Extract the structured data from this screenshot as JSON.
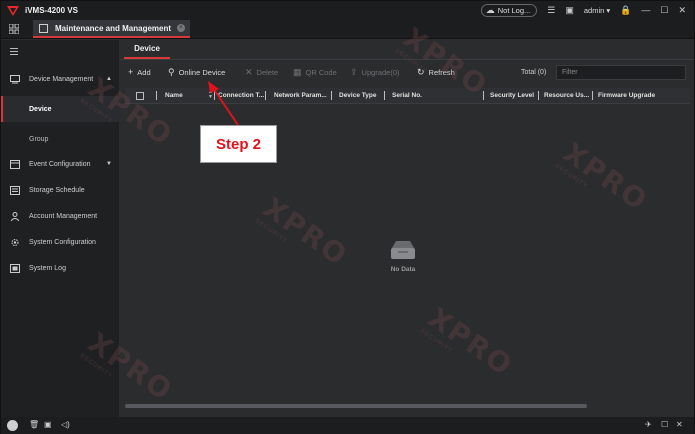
{
  "app": {
    "title": "iVMS-4200 VS",
    "not_logged": "Not Log...",
    "user": "admin"
  },
  "tab": {
    "label": "Maintenance and Management"
  },
  "sidebar": {
    "items": [
      {
        "label": "Device Management",
        "icon": "device-management-icon"
      },
      {
        "label": "Device"
      },
      {
        "label": "Group"
      },
      {
        "label": "Event Configuration",
        "icon": "event-config-icon"
      },
      {
        "label": "Storage Schedule",
        "icon": "storage-schedule-icon"
      },
      {
        "label": "Account Management",
        "icon": "account-icon"
      },
      {
        "label": "System Configuration",
        "icon": "gear-icon"
      },
      {
        "label": "System Log",
        "icon": "log-icon"
      }
    ]
  },
  "main": {
    "subtab": "Device",
    "toolbar": {
      "add": "Add",
      "online_device": "Online Device",
      "delete": "Delete",
      "qr_code": "QR Code",
      "upgrade": "Upgrade(0)",
      "refresh": "Refresh",
      "total": "Total (0)",
      "filter_placeholder": "Filter"
    },
    "columns": [
      "Name",
      "Connection T...",
      "Network Param...",
      "Device Type",
      "Serial No.",
      "Security Level",
      "Resource Us...",
      "Firmware Upgrade"
    ],
    "empty_text": "No Data"
  },
  "annotation": {
    "label": "Step 2"
  },
  "watermark": {
    "big": "XPRO",
    "small": "SECURITY"
  },
  "colors": {
    "accent": "#d43a3a",
    "annotation": "#e0121b"
  }
}
